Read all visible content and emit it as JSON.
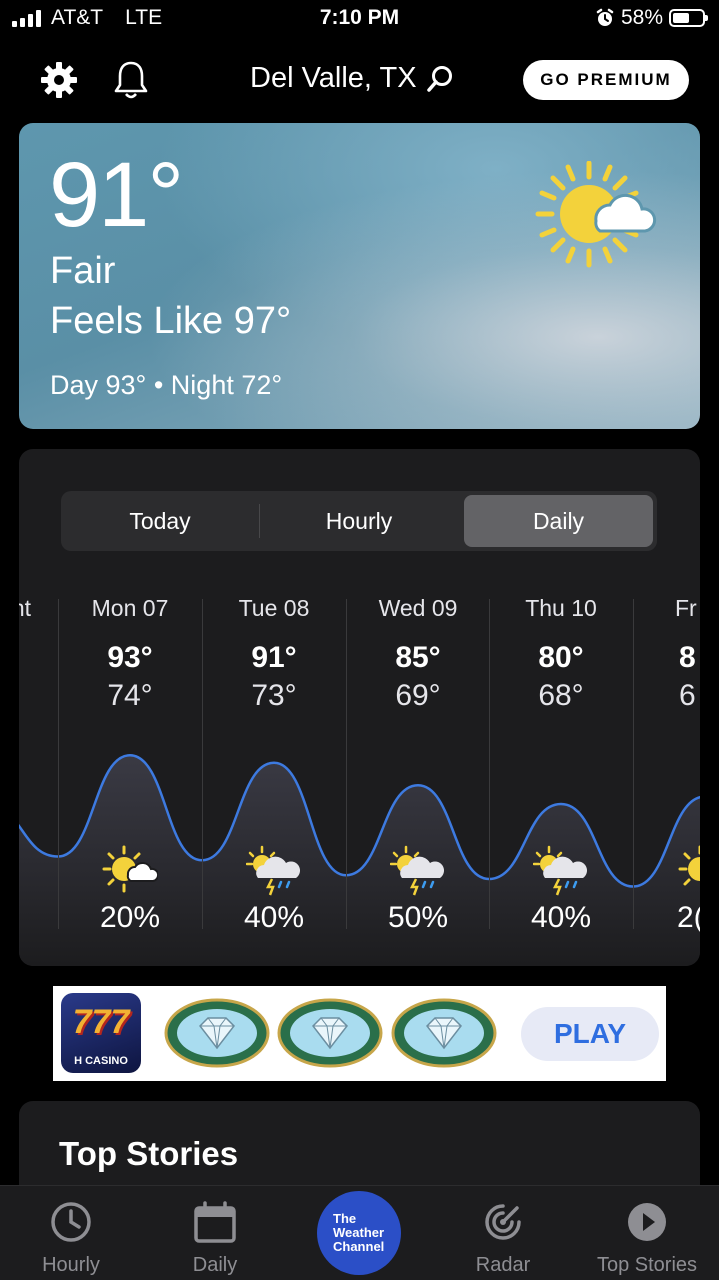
{
  "status_bar": {
    "carrier": "AT&T",
    "network": "LTE",
    "time": "7:10 PM",
    "battery": "58%",
    "battery_level": 0.58
  },
  "header": {
    "location": "Del Valle, TX",
    "premium_label": "GO PREMIUM"
  },
  "current": {
    "temperature": "91°",
    "condition": "Fair",
    "feels_like": "Feels Like 97°",
    "day_night": "Day 93° • Night 72°",
    "icon": "sun-cloud-icon"
  },
  "forecast": {
    "tabs": [
      {
        "label": "Today",
        "active": false
      },
      {
        "label": "Hourly",
        "active": false
      },
      {
        "label": "Daily",
        "active": true
      }
    ],
    "days": [
      {
        "name": "nt",
        "hi": "",
        "lo": "",
        "icon": "",
        "precip": ""
      },
      {
        "name": "Mon 07",
        "hi": "93°",
        "lo": "74°",
        "icon": "sun-cloud-icon",
        "precip": "20%"
      },
      {
        "name": "Tue 08",
        "hi": "91°",
        "lo": "73°",
        "icon": "scattered-thunderstorms-icon",
        "precip": "40%"
      },
      {
        "name": "Wed 09",
        "hi": "85°",
        "lo": "69°",
        "icon": "scattered-thunderstorms-icon",
        "precip": "50%"
      },
      {
        "name": "Thu 10",
        "hi": "80°",
        "lo": "68°",
        "icon": "scattered-thunderstorms-icon",
        "precip": "40%"
      },
      {
        "name": "Fr",
        "hi": "8",
        "lo": "6",
        "icon": "sun-cloud-icon",
        "precip": "2("
      }
    ]
  },
  "ad": {
    "brand": "H CASINO",
    "logo_text": "777",
    "game": "DIAMONDS DIAMONDS",
    "cta": "PLAY"
  },
  "top_stories": {
    "title": "Top Stories"
  },
  "tab_bar": {
    "items": [
      {
        "label": "Hourly",
        "icon": "clock-icon"
      },
      {
        "label": "Daily",
        "icon": "calendar-icon"
      },
      {
        "label": "Radar",
        "icon": "radar-icon"
      },
      {
        "label": "Top Stories",
        "icon": "play-icon"
      }
    ],
    "center_logo": "The\nWeather\nChannel"
  },
  "colors": {
    "accent_blue": "#2b4fc7",
    "chart_line": "#3d7ae0",
    "sun": "#f3d23b"
  }
}
